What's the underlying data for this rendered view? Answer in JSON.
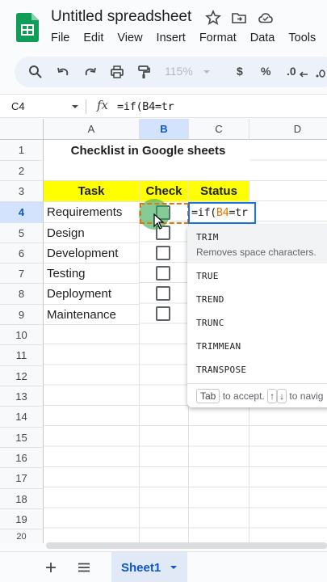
{
  "app": {
    "title": "Untitled spreadsheet",
    "menu": [
      "File",
      "Edit",
      "View",
      "Insert",
      "Format",
      "Data",
      "Tools"
    ]
  },
  "toolbar": {
    "zoom": "115%",
    "currency": "$",
    "percent": "%",
    "decimal_decrease": ".0"
  },
  "formula_bar": {
    "name_box": "C4",
    "fx": "fx",
    "formula": "=if(B4=tr"
  },
  "columns": [
    "A",
    "B",
    "C",
    "D"
  ],
  "rows": [
    "1",
    "2",
    "3",
    "4",
    "5",
    "6",
    "7",
    "8",
    "9",
    "10",
    "11",
    "12",
    "13",
    "14",
    "15",
    "16",
    "17",
    "18",
    "19",
    "20"
  ],
  "sheet": {
    "title": "Checklist in Google sheets",
    "headers": {
      "task": "Task",
      "check": "Check",
      "status": "Status"
    },
    "tasks": [
      "Requirements",
      "Design",
      "Development",
      "Testing",
      "Deployment",
      "Maintenance"
    ]
  },
  "active_cell": {
    "prefix": "=if(",
    "ref": "B4",
    "suffix": "=tr"
  },
  "autocomplete": {
    "top": {
      "name": "TRIM",
      "description": "Removes space characters."
    },
    "items": [
      "TRUE",
      "TREND",
      "TRUNC",
      "TRIMMEAN",
      "TRANSPOSE"
    ],
    "footer": {
      "key1": "Tab",
      "text1": "to accept.",
      "key2": "↑",
      "key3": "↓",
      "text2": "to navig"
    }
  },
  "bottom": {
    "sheet_tab": "Sheet1"
  },
  "colors": {
    "header_highlight": "#ffff00",
    "selection_blue": "#1a73e8",
    "reference_orange": "#e37400",
    "sheets_green": "#0f9d58"
  }
}
